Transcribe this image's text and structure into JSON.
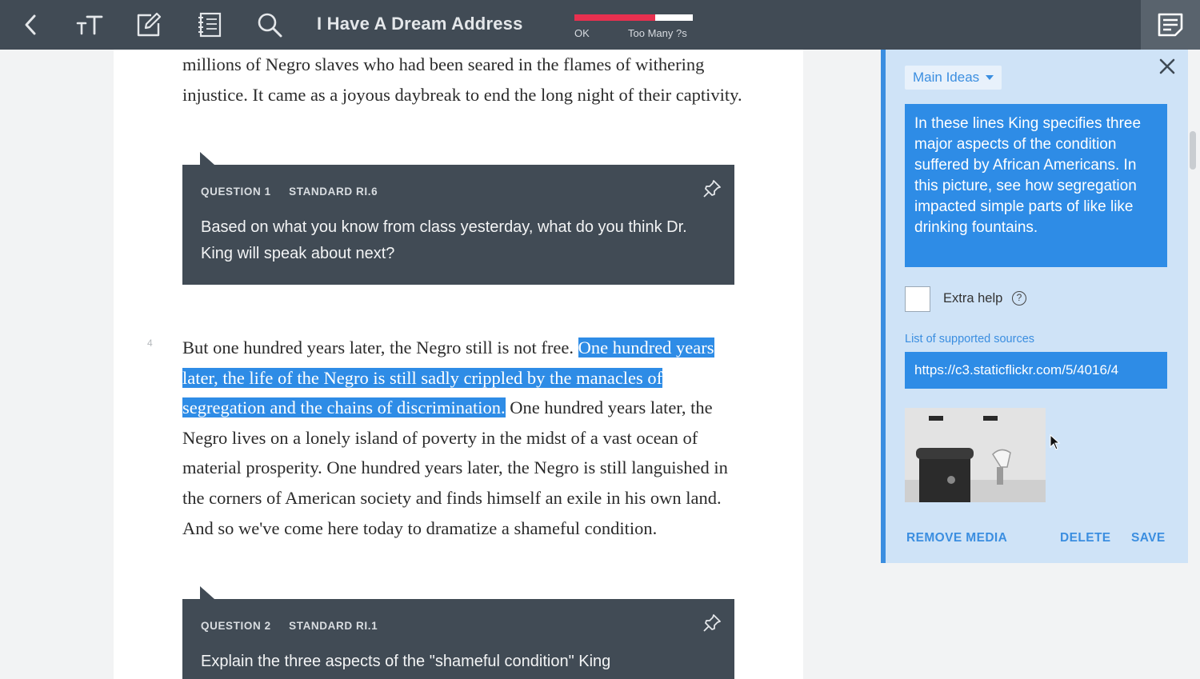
{
  "toolbar": {
    "title": "I Have A Dream Address",
    "meter_fraction": 0.68,
    "meter_left_label": "OK",
    "meter_right_label": "Too Many ?s",
    "icons": [
      "back-icon",
      "text-size-icon",
      "edit-icon",
      "notebook-icon",
      "search-icon",
      "notes-panel-icon"
    ]
  },
  "document": {
    "para_top": "millions of Negro slaves who had been seared in the flames of withering injustice. It came as a joyous daybreak to end the long night of their captivity.",
    "question1": {
      "number": "QUESTION 1",
      "standard": "STANDARD RI.6",
      "text": "Based on what you know from class yesterday, what do you think Dr. King will speak about next?"
    },
    "para4": {
      "line_number": "4",
      "before": "But one hundred years later, the Negro still is not free. ",
      "highlight": "One hundred years later, the life of the Negro is still sadly crippled by the manacles of segregation and the chains of discrimination.",
      "after": " One hundred years later, the Negro lives on a lonely island of poverty in the midst of a vast ocean of material prosperity. One hundred years later, the Negro is still languished in the corners of American society and finds himself an exile in his own land. And so we've come here today to dramatize a shameful condition."
    },
    "question2": {
      "number": "QUESTION 2",
      "standard": "STANDARD RI.1",
      "text": "Explain the three aspects of the \"shameful condition\" King"
    }
  },
  "panel": {
    "category": "Main Ideas",
    "note": "In these lines King specifies three major aspects of the condition suffered by African Americans. In this picture, see how segregation impacted simple parts of like like drinking fountains.",
    "extra_help_label": "Extra help",
    "extra_help_checked": false,
    "sources_label": "List of supported sources",
    "source_url": "https://c3.staticflickr.com/5/4016/4",
    "remove_media": "REMOVE MEDIA",
    "delete": "DELETE",
    "save": "SAVE"
  },
  "colors": {
    "toolbar_bg": "#414b55",
    "accent": "#2e8ce6",
    "meter_red": "#e8304f",
    "panel_bg": "#cfe3f7"
  }
}
